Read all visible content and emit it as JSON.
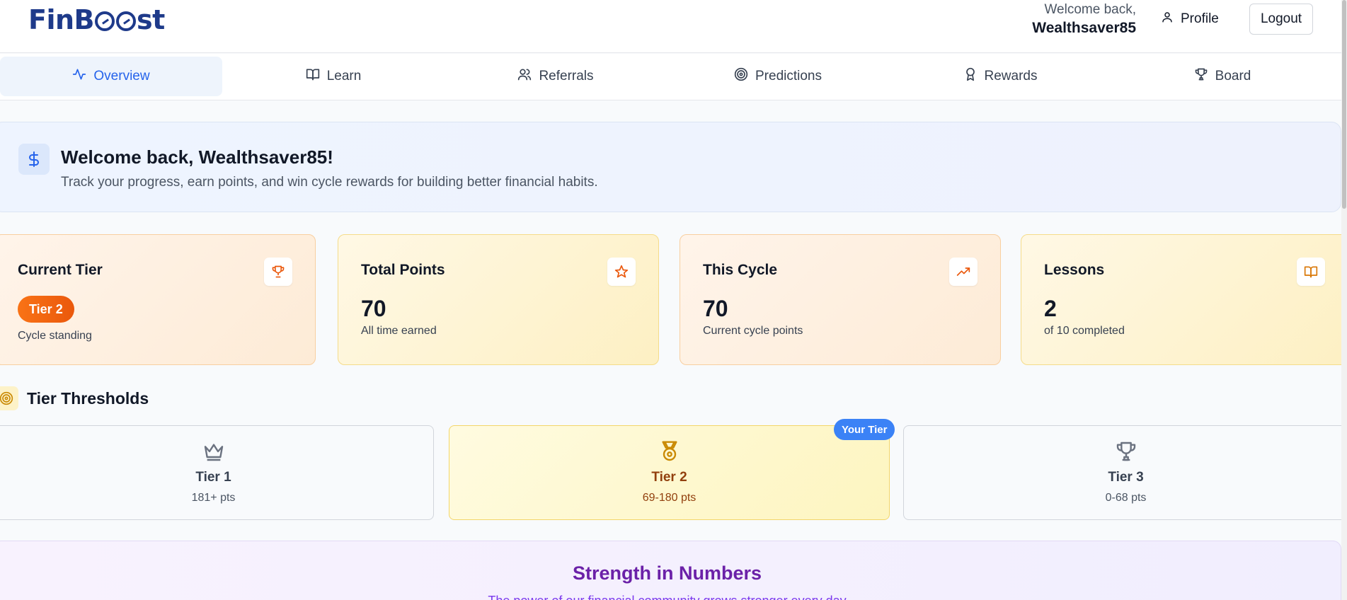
{
  "brand": {
    "name_part1": "FinB",
    "name_part2": "st"
  },
  "header": {
    "welcome_small": "Welcome back,",
    "username": "Wealthsaver85",
    "profile_label": "Profile",
    "logout_label": "Logout"
  },
  "tabs": [
    {
      "label": "Overview",
      "icon": "activity-icon",
      "active": true
    },
    {
      "label": "Learn",
      "icon": "book-icon"
    },
    {
      "label": "Referrals",
      "icon": "users-icon"
    },
    {
      "label": "Predictions",
      "icon": "target-icon"
    },
    {
      "label": "Rewards",
      "icon": "award-icon"
    },
    {
      "label": "Board",
      "icon": "trophy-icon"
    }
  ],
  "banner": {
    "icon": "dollar-icon",
    "title": "Welcome back, Wealthsaver85!",
    "subtitle": "Track your progress, earn points, and win cycle rewards for building better financial habits."
  },
  "stats": {
    "tier": {
      "title": "Current Tier",
      "value": "Tier 2",
      "sub": "Cycle standing",
      "icon": "trophy-icon"
    },
    "total": {
      "title": "Total Points",
      "value": "70",
      "sub": "All time earned",
      "icon": "star-icon"
    },
    "cycle": {
      "title": "This Cycle",
      "value": "70",
      "sub": "Current cycle points",
      "icon": "trending-up-icon"
    },
    "lessons": {
      "title": "Lessons",
      "value": "2",
      "sub": "of 10 completed",
      "icon": "book-icon"
    }
  },
  "thresholds": {
    "title": "Tier Thresholds",
    "your_tier_badge": "Your Tier",
    "tiers": [
      {
        "name": "Tier 1",
        "points": "181+ pts",
        "icon": "crown-icon"
      },
      {
        "name": "Tier 2",
        "points": "69-180 pts",
        "icon": "medal-icon",
        "current": true
      },
      {
        "name": "Tier 3",
        "points": "0-68 pts",
        "icon": "trophy-icon"
      }
    ]
  },
  "strength": {
    "title": "Strength in Numbers",
    "subtitle": "The power of our financial community grows stronger every day"
  },
  "colors": {
    "brand": "#1e3a8a",
    "accent": "#2563eb",
    "tier_pill": "#f97316",
    "badge": "#3b82f6",
    "strength": "#6b21a8"
  }
}
